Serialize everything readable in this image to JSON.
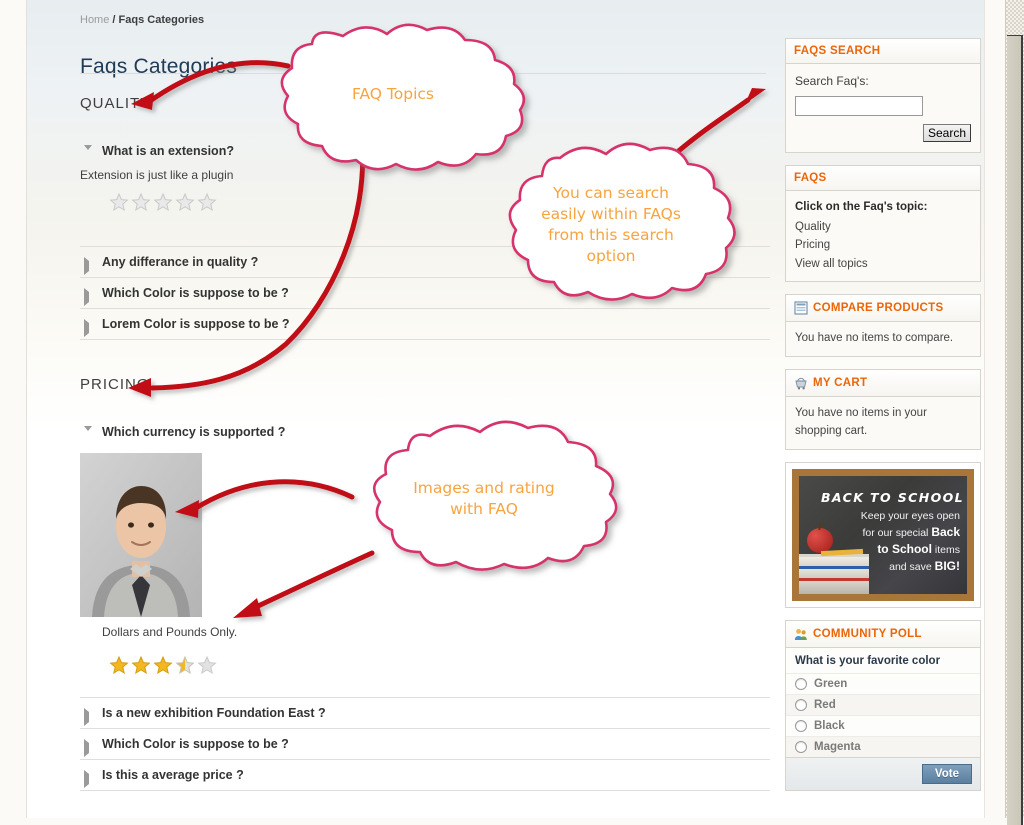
{
  "breadcrumb": {
    "home": "Home",
    "separator": "/",
    "current": "Faqs Categories"
  },
  "page": {
    "title": "Faqs Categories"
  },
  "categories": [
    {
      "name": "QUALITY",
      "items": [
        {
          "question": "What is an extension?",
          "open": true,
          "answer": "Extension is just like a plugin",
          "rating": 0,
          "image": false
        },
        {
          "question": "Any differance in quality ?",
          "open": false
        },
        {
          "question": "Which Color is suppose to be ?",
          "open": false
        },
        {
          "question": "Lorem Color is suppose to be ?",
          "open": false
        }
      ]
    },
    {
      "name": "PRICING",
      "items": [
        {
          "question": "Which currency is supported ?",
          "open": true,
          "answer": "Dollars and Pounds Only.",
          "rating": 3.5,
          "image": true,
          "image_alt": "man-in-shirt-and-tie-photo"
        },
        {
          "question": "Is a new exhibition Foundation East ?",
          "open": false
        },
        {
          "question": "Which Color is suppose to be ?",
          "open": false
        },
        {
          "question": "Is this a average price ?",
          "open": false
        }
      ]
    }
  ],
  "sidebar": {
    "faqs_search": {
      "title": "FAQS SEARCH",
      "field_label": "Search Faq's:",
      "input_value": "",
      "input_placeholder": "",
      "button_label": "Search"
    },
    "faqs": {
      "title": "FAQS",
      "lead": "Click on the Faq's topic:",
      "links": [
        "Quality",
        "Pricing",
        "View all topics"
      ]
    },
    "compare": {
      "title": "COMPARE PRODUCTS",
      "icon": "compare-list-icon",
      "empty_text": "You have no items to compare."
    },
    "cart": {
      "title": "MY CART",
      "icon": "shopping-cart-icon",
      "empty_text": "You have no items in your shopping cart."
    },
    "banner": {
      "alt": "back-to-school-banner",
      "headline": "BACK TO SCHOOL",
      "line1": "Keep your eyes open",
      "line2": "for our special ",
      "line2_b": "Back",
      "line3_b": "to School",
      "line3": " items",
      "line4": "and save ",
      "line4_b": "BIG!"
    },
    "poll": {
      "title": "COMMUNITY POLL",
      "icon": "community-people-icon",
      "question": "What is your favorite color",
      "options": [
        "Green",
        "Red",
        "Black",
        "Magenta"
      ],
      "selected": null,
      "button_label": "Vote"
    }
  },
  "callouts": [
    {
      "id": "faq-topics",
      "text": "FAQ Topics",
      "points_to": [
        "QUALITY heading",
        "PRICING heading"
      ]
    },
    {
      "id": "search-callout",
      "text": "You can search\neasily within FAQs\nfrom this search\noption",
      "points_to": [
        "FAQS SEARCH box"
      ]
    },
    {
      "id": "images-rating-callout",
      "text": "Images and rating\nwith FAQ",
      "points_to": [
        "faq image",
        "star rating"
      ]
    }
  ],
  "colors": {
    "accent_orange": "#eb6608",
    "callout_text": "#f7a440",
    "callout_outline": "#d6336c",
    "arrow_red": "#c00718",
    "title_blue": "#1f3b55",
    "star_gold": "#f3b721",
    "star_empty": "#d8d8d8",
    "vote_button": "#5b7fa0"
  },
  "scrollbar": {
    "name": "vertical-scrollbar",
    "thumb_top_pct": 4
  }
}
